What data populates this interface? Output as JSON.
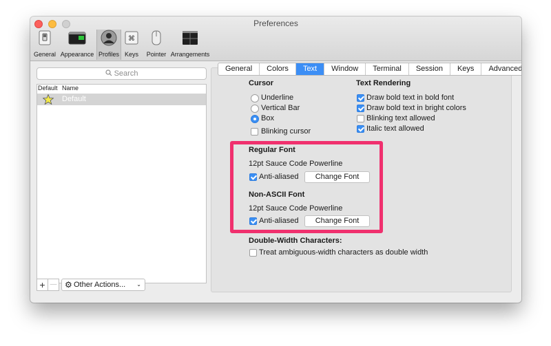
{
  "window": {
    "title": "Preferences"
  },
  "toolbar": [
    {
      "id": "general",
      "label": "General",
      "icon": "switch-icon"
    },
    {
      "id": "appearance",
      "label": "Appearance",
      "icon": "terminal-window-icon"
    },
    {
      "id": "profiles",
      "label": "Profiles",
      "icon": "person-icon",
      "active": true
    },
    {
      "id": "keys",
      "label": "Keys",
      "icon": "command-key-icon"
    },
    {
      "id": "pointer",
      "label": "Pointer",
      "icon": "mouse-icon"
    },
    {
      "id": "arrangements",
      "label": "Arrangements",
      "icon": "window-arrangement-icon"
    }
  ],
  "search": {
    "placeholder": "Search"
  },
  "profiles_list": {
    "col_default": "Default",
    "col_name": "Name",
    "rows": [
      {
        "name": "Default",
        "is_default": true
      }
    ]
  },
  "bottom_bar": {
    "add": "+",
    "remove": "—",
    "other_actions": "Other Actions..."
  },
  "tabs": [
    "General",
    "Colors",
    "Text",
    "Window",
    "Terminal",
    "Session",
    "Keys",
    "Advanced"
  ],
  "active_tab": "Text",
  "cursor": {
    "heading": "Cursor",
    "options": [
      "Underline",
      "Vertical Bar",
      "Box"
    ],
    "selected": "Box",
    "blinking_label": "Blinking cursor",
    "blinking": false
  },
  "text_rendering": {
    "heading": "Text Rendering",
    "options": [
      {
        "label": "Draw bold text in bold font",
        "checked": true
      },
      {
        "label": "Draw bold text in bright colors",
        "checked": true
      },
      {
        "label": "Blinking text allowed",
        "checked": false
      },
      {
        "label": "Italic text allowed",
        "checked": true
      }
    ]
  },
  "regular_font": {
    "heading": "Regular Font",
    "font": "12pt Sauce Code Powerline",
    "antialias_label": "Anti-aliased",
    "antialiased": true,
    "button": "Change Font"
  },
  "non_ascii_font": {
    "heading": "Non-ASCII Font",
    "font": "12pt Sauce Code Powerline",
    "antialias_label": "Anti-aliased",
    "antialiased": true,
    "button": "Change Font"
  },
  "double_width": {
    "heading": "Double-Width Characters:",
    "label": "Treat ambiguous-width characters as double width",
    "checked": false
  },
  "colors": {
    "accent": "#3b8ff3",
    "highlight": "#f0306e",
    "selected_row": "#d4d4d4"
  }
}
